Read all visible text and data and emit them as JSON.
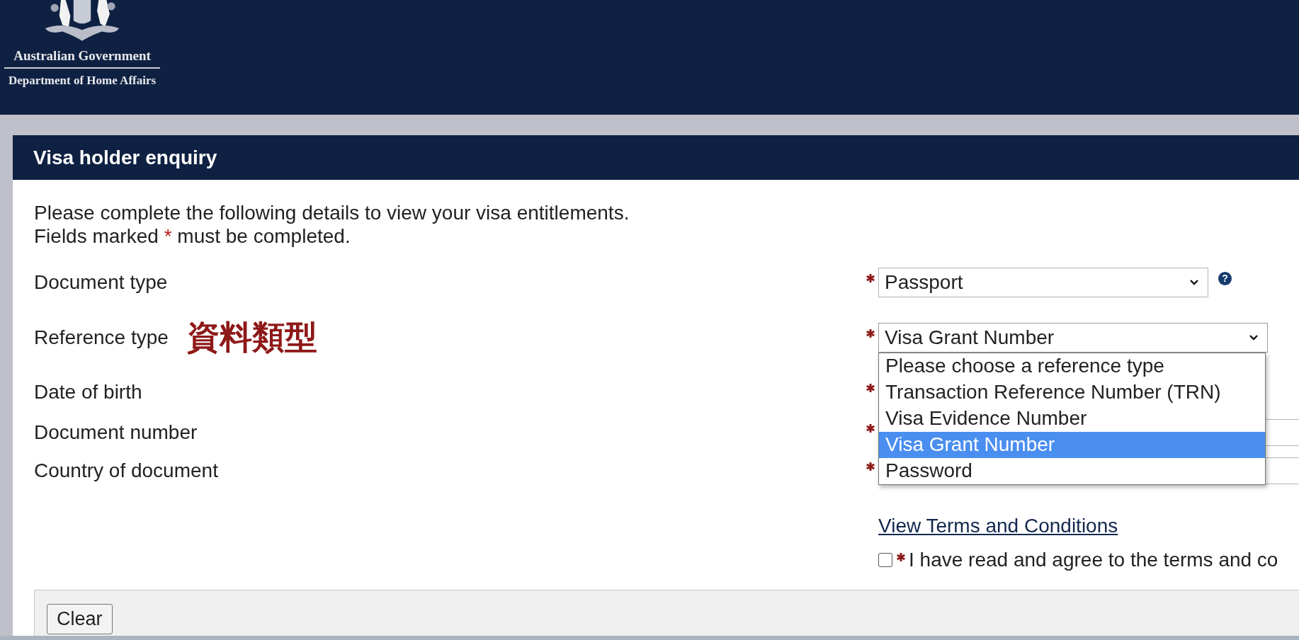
{
  "header": {
    "logo_lines": [
      "Australian Government",
      "Department of Home Affairs"
    ]
  },
  "panel": {
    "title": "Visa holder enquiry",
    "intro": "Please complete the following details to view your visa entitlements.",
    "required_note": {
      "before": "Fields marked",
      "mark": "*",
      "after": "must be completed."
    },
    "fields": [
      {
        "label": "Document type",
        "required": true,
        "kind": "select",
        "value": "Passport",
        "help": "?"
      },
      {
        "label": "Reference type",
        "annotation": "資料類型",
        "required": true,
        "kind": "select",
        "value": "Visa Grant Number",
        "expanded": true,
        "options": [
          {
            "label": "Please choose a reference type",
            "selected": false
          },
          {
            "label": "Transaction Reference Number (TRN)",
            "selected": false
          },
          {
            "label": "Visa Evidence Number",
            "selected": false
          },
          {
            "label": "Visa Grant Number",
            "selected": true
          },
          {
            "label": "Password",
            "selected": false
          }
        ]
      },
      {
        "label": "Date of birth",
        "required": true
      },
      {
        "label": "Document number",
        "required": true,
        "kind": "input"
      },
      {
        "label": "Country of document",
        "required": true,
        "kind": "input"
      }
    ],
    "terms": {
      "link": "View Terms and Conditions",
      "agree": {
        "checked": false,
        "required": true,
        "label": "I have read and agree to the terms and co"
      }
    },
    "footer": {
      "buttons": [
        "Clear"
      ]
    }
  }
}
